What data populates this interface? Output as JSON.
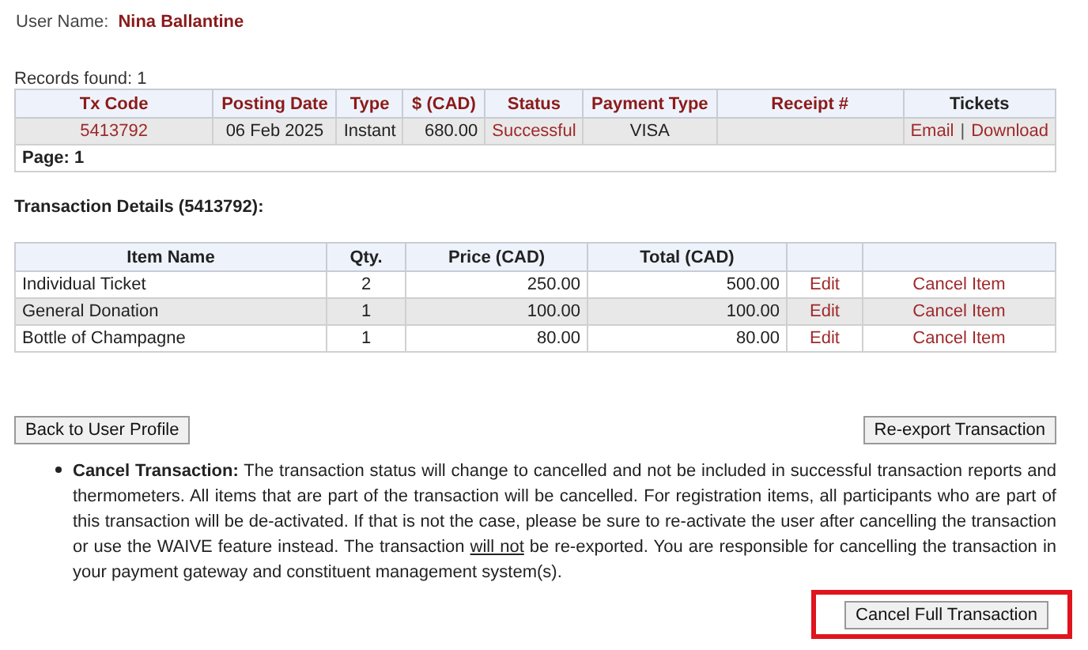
{
  "user": {
    "label": "User Name:",
    "name": "Nina Ballantine"
  },
  "records_found": "Records found: 1",
  "transactions": {
    "columns": [
      "Tx Code",
      "Posting Date",
      "Type",
      "$ (CAD)",
      "Status",
      "Payment Type",
      "Receipt #",
      "Tickets"
    ],
    "rows": [
      {
        "tx_code": "5413792",
        "posting_date": "06 Feb 2025",
        "type": "Instant",
        "amount": "680.00",
        "status": "Successful",
        "payment_type": "VISA",
        "receipt": "",
        "tickets": [
          "Email",
          "Download"
        ],
        "separator": "|"
      }
    ],
    "page": "Page: 1"
  },
  "details": {
    "title": "Transaction Details (5413792):",
    "columns": [
      "Item Name",
      "Qty.",
      "Price (CAD)",
      "Total (CAD)"
    ],
    "rows": [
      {
        "item": "Individual Ticket",
        "qty": "2",
        "price": "250.00",
        "total": "500.00",
        "edit": "Edit",
        "cancel": "Cancel Item"
      },
      {
        "item": "General Donation",
        "qty": "1",
        "price": "100.00",
        "total": "100.00",
        "edit": "Edit",
        "cancel": "Cancel Item"
      },
      {
        "item": "Bottle of Champagne",
        "qty": "1",
        "price": "80.00",
        "total": "80.00",
        "edit": "Edit",
        "cancel": "Cancel Item"
      }
    ]
  },
  "buttons": {
    "back": "Back to User Profile",
    "reexport": "Re-export Transaction"
  },
  "note": {
    "segments": [
      {
        "text": "**Cancel Transaction:** The transaction status will change to cancelled and not be included in successful transaction reports and thermometers. All items that are part of the transaction will be cancelled. For registration items, all participants who are part of this transaction will be de-activated. If that is not the case, please be sure to re-activate the user after cancelling the transaction or use the WAIVE feature instead. The transaction ",
        "underline": false
      },
      {
        "text": "will not",
        "underline": true
      },
      {
        "text": " be re-exported. You are responsible for cancelling the transaction in your payment gateway and constituent management system(s).",
        "underline": false
      }
    ]
  },
  "cancel_full": {
    "label": "Cancel Full Transaction",
    "highlighted": true
  }
}
